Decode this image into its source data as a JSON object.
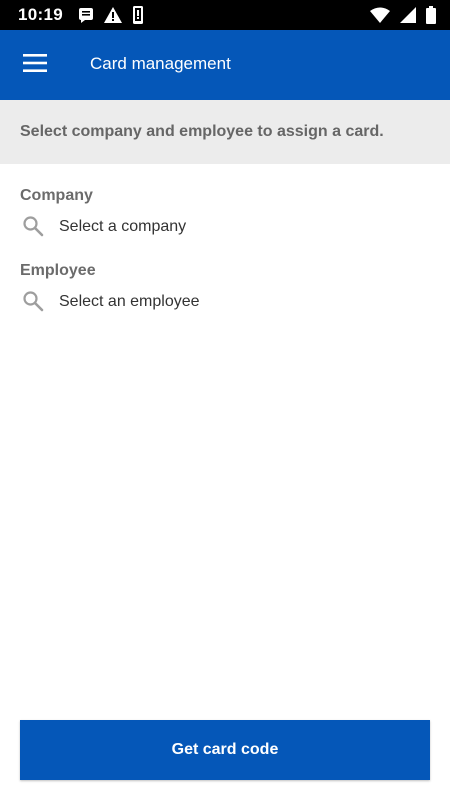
{
  "status_bar": {
    "time": "10:19",
    "left_icons": [
      "message-icon",
      "warning-icon",
      "phone-vibrate-icon"
    ],
    "right_icons": [
      "wifi-icon",
      "signal-icon",
      "battery-icon"
    ]
  },
  "app_bar": {
    "menu_icon": "hamburger-menu-icon",
    "title": "Card management"
  },
  "banner": {
    "text": "Select company and employee to assign a card."
  },
  "company": {
    "label": "Company",
    "icon": "search-icon",
    "placeholder": "Select a company"
  },
  "employee": {
    "label": "Employee",
    "icon": "search-icon",
    "placeholder": "Select an employee"
  },
  "action": {
    "label": "Get card code"
  },
  "colors": {
    "primary": "#0557b8",
    "banner_bg": "#ececec",
    "label_gray": "#6b6b6b",
    "status_bar": "#000000"
  }
}
